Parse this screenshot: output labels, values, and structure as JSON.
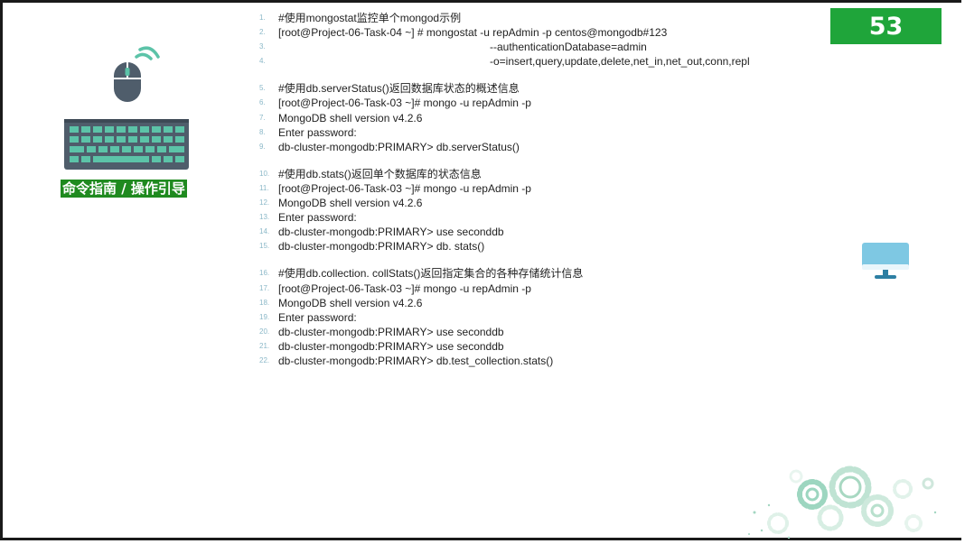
{
  "page": {
    "number": "53",
    "guide_label": "命令指南 / 操作引导"
  },
  "icons": {
    "mouse": "wireless-mouse-icon",
    "keyboard": "keyboard-icon",
    "monitor": "monitor-icon",
    "gears": "gears-decoration-icon"
  },
  "colors": {
    "accent_green": "#1fa53a",
    "label_green": "#1f8a1f",
    "icon_teal": "#5cc3a8",
    "icon_slate": "#4f5d6b",
    "monitor_blue": "#7ec8e3"
  },
  "code_blocks": [
    {
      "lines": [
        {
          "n": "1.",
          "t": "#使用mongostat监控单个mongod示例",
          "indent": 0
        },
        {
          "n": "2.",
          "t": "[root@Project-06-Task-04 ~] # mongostat -u repAdmin -p centos@mongodb#123",
          "indent": 0
        },
        {
          "n": "3.",
          "t": "--authenticationDatabase=admin",
          "indent": 234
        },
        {
          "n": "4.",
          "t": "-o=insert,query,update,delete,net_in,net_out,conn,repl",
          "indent": 234
        }
      ]
    },
    {
      "lines": [
        {
          "n": "5.",
          "t": "#使用db.serverStatus()返回数据库状态的概述信息",
          "indent": 0
        },
        {
          "n": "6.",
          "t": "[root@Project-06-Task-03 ~]# mongo -u repAdmin -p",
          "indent": 0
        },
        {
          "n": "7.",
          "t": "MongoDB shell version v4.2.6",
          "indent": 0
        },
        {
          "n": "8.",
          "t": "Enter password:",
          "indent": 0
        },
        {
          "n": "9.",
          "t": "db-cluster-mongodb:PRIMARY> db.serverStatus()",
          "indent": 0
        }
      ]
    },
    {
      "lines": [
        {
          "n": "10.",
          "t": "#使用db.stats()返回单个数据库的状态信息",
          "indent": 0
        },
        {
          "n": "11.",
          "t": "[root@Project-06-Task-03 ~]# mongo -u repAdmin -p",
          "indent": 0
        },
        {
          "n": "12.",
          "t": "MongoDB shell version v4.2.6",
          "indent": 0
        },
        {
          "n": "13.",
          "t": "Enter password:",
          "indent": 0
        },
        {
          "n": "14.",
          "t": "db-cluster-mongodb:PRIMARY> use seconddb",
          "indent": 0
        },
        {
          "n": "15.",
          "t": "db-cluster-mongodb:PRIMARY> db. stats()",
          "indent": 0
        }
      ]
    },
    {
      "lines": [
        {
          "n": "16.",
          "t": "#使用db.collection. collStats()返回指定集合的各种存储统计信息",
          "indent": 0
        },
        {
          "n": "17.",
          "t": "[root@Project-06-Task-03 ~]# mongo -u repAdmin -p",
          "indent": 0
        },
        {
          "n": "18.",
          "t": "MongoDB shell version v4.2.6",
          "indent": 0
        },
        {
          "n": "19.",
          "t": "Enter password:",
          "indent": 0
        },
        {
          "n": "20.",
          "t": "db-cluster-mongodb:PRIMARY> use seconddb",
          "indent": 0
        },
        {
          "n": "21.",
          "t": "db-cluster-mongodb:PRIMARY> use seconddb",
          "indent": 0
        },
        {
          "n": "22.",
          "t": "db-cluster-mongodb:PRIMARY> db.test_collection.stats()",
          "indent": 0
        }
      ]
    }
  ]
}
